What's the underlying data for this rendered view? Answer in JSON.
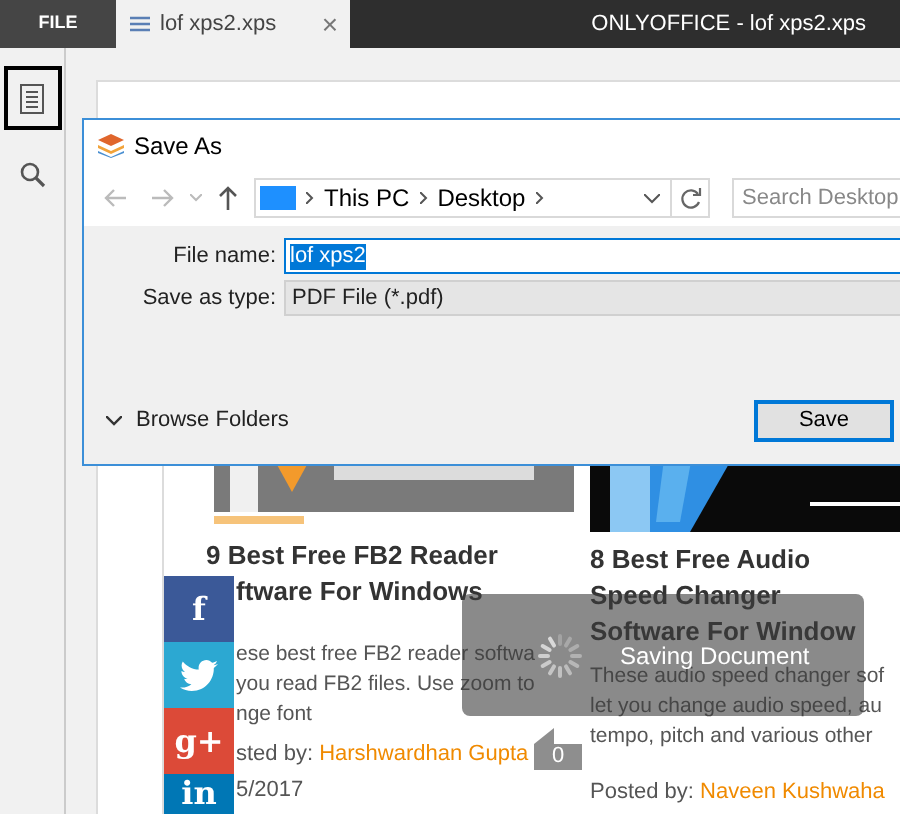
{
  "app_bar": {
    "file_tab": "FILE",
    "document_tab": {
      "label": "lof xps2.xps",
      "close": "×"
    },
    "window_title": "ONLYOFFICE - lof xps2.xps"
  },
  "left_toolbar": [
    {
      "kind": "thumbnails",
      "selected": true
    },
    {
      "kind": "search",
      "selected": false
    }
  ],
  "dialog": {
    "title": "Save As",
    "breadcrumb": [
      "This PC",
      "Desktop"
    ],
    "search": {
      "placeholder": "Search Desktop"
    },
    "fields": [
      {
        "kind": "text",
        "label": "File name:",
        "value": "lof xps2"
      },
      {
        "kind": "select",
        "label": "Save as type:",
        "value": "PDF File (*.pdf)"
      }
    ],
    "browse_folders": "Browse Folders",
    "save_button": "Save"
  },
  "articles": [
    {
      "kind": "picture",
      "covered_by_share_bar": true,
      "title_lines": [
        "9 Best Free FB2 Reader",
        "ftware For Windows"
      ],
      "description_lines": [
        "ese best free FB2 reader softwa",
        "you read FB2 files. Use zoom to",
        "nge font"
      ],
      "posted_by": "sted by: ",
      "author": "Harshwardhan Gupta",
      "date": "5/2017"
    },
    {
      "kind": "picture",
      "covered_by_share_bar": false,
      "title_lines": [
        "8 Best Free Audio",
        "Speed Changer",
        "Software For Window"
      ],
      "description_lines": [
        "These audio speed changer sof",
        "let you change audio speed, au",
        "tempo, pitch and various other"
      ],
      "posted_by": "Posted by: ",
      "author": "Naveen Kushwaha"
    }
  ],
  "share_bar": [
    {
      "kind": "facebook",
      "label": "f",
      "color": "#3b5998"
    },
    {
      "kind": "twitter",
      "color": "#2ca8d2"
    },
    {
      "kind": "googleplus",
      "label": "g+",
      "color": "#dc4a38"
    },
    {
      "kind": "linkedin",
      "label": "in",
      "color": "#0077b5"
    }
  ],
  "comment_count": "0",
  "saving_overlay": {
    "text": "Saving Document"
  }
}
